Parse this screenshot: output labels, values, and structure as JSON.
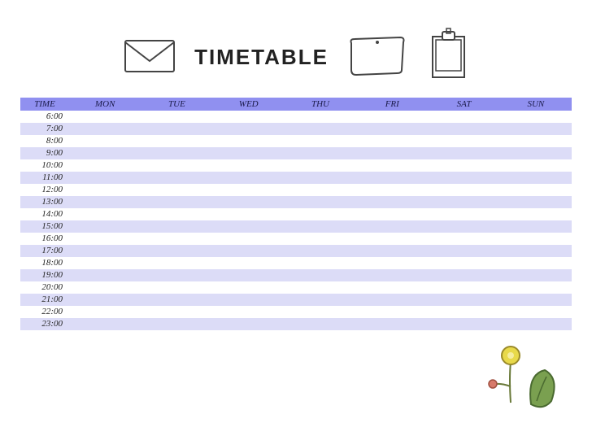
{
  "title": "TIMETABLE",
  "columns": [
    "TIME",
    "MON",
    "TUE",
    "WED",
    "THU",
    "FRI",
    "SAT",
    "SUN"
  ],
  "rows": [
    {
      "time": "6:00",
      "cells": [
        "",
        "",
        "",
        "",
        "",
        "",
        ""
      ]
    },
    {
      "time": "7:00",
      "cells": [
        "",
        "",
        "",
        "",
        "",
        "",
        ""
      ]
    },
    {
      "time": "8:00",
      "cells": [
        "",
        "",
        "",
        "",
        "",
        "",
        ""
      ]
    },
    {
      "time": "9:00",
      "cells": [
        "",
        "",
        "",
        "",
        "",
        "",
        ""
      ]
    },
    {
      "time": "10:00",
      "cells": [
        "",
        "",
        "",
        "",
        "",
        "",
        ""
      ]
    },
    {
      "time": "11:00",
      "cells": [
        "",
        "",
        "",
        "",
        "",
        "",
        ""
      ]
    },
    {
      "time": "12:00",
      "cells": [
        "",
        "",
        "",
        "",
        "",
        "",
        ""
      ]
    },
    {
      "time": "13:00",
      "cells": [
        "",
        "",
        "",
        "",
        "",
        "",
        ""
      ]
    },
    {
      "time": "14:00",
      "cells": [
        "",
        "",
        "",
        "",
        "",
        "",
        ""
      ]
    },
    {
      "time": "15:00",
      "cells": [
        "",
        "",
        "",
        "",
        "",
        "",
        ""
      ]
    },
    {
      "time": "16:00",
      "cells": [
        "",
        "",
        "",
        "",
        "",
        "",
        ""
      ]
    },
    {
      "time": "17:00",
      "cells": [
        "",
        "",
        "",
        "",
        "",
        "",
        ""
      ]
    },
    {
      "time": "18:00",
      "cells": [
        "",
        "",
        "",
        "",
        "",
        "",
        ""
      ]
    },
    {
      "time": "19:00",
      "cells": [
        "",
        "",
        "",
        "",
        "",
        "",
        ""
      ]
    },
    {
      "time": "20:00",
      "cells": [
        "",
        "",
        "",
        "",
        "",
        "",
        ""
      ]
    },
    {
      "time": "21:00",
      "cells": [
        "",
        "",
        "",
        "",
        "",
        "",
        ""
      ]
    },
    {
      "time": "22:00",
      "cells": [
        "",
        "",
        "",
        "",
        "",
        "",
        ""
      ]
    },
    {
      "time": "23:00",
      "cells": [
        "",
        "",
        "",
        "",
        "",
        "",
        ""
      ]
    }
  ]
}
